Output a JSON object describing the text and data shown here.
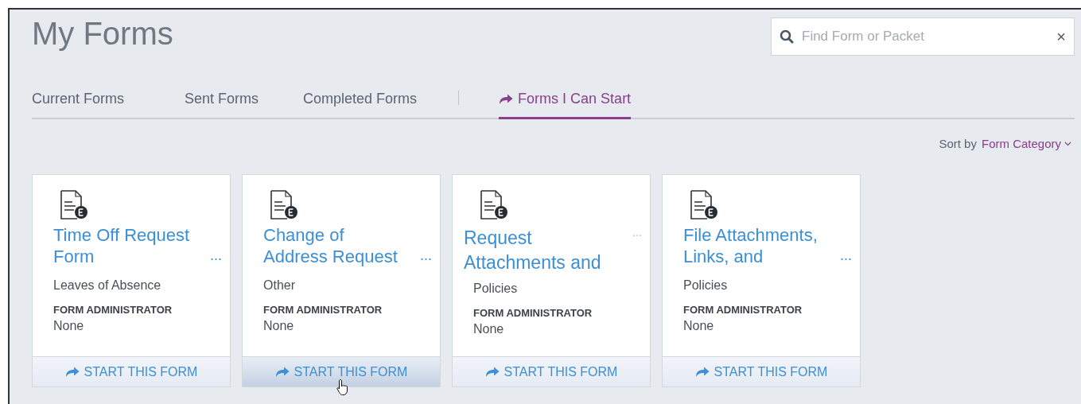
{
  "page": {
    "title": "My Forms"
  },
  "search": {
    "placeholder": "Find Form or Packet",
    "clear": "×"
  },
  "tabs": [
    {
      "label": "Current Forms",
      "selected": false
    },
    {
      "label": "Sent Forms",
      "selected": false
    },
    {
      "label": "Completed Forms",
      "selected": false
    },
    {
      "label": "Forms I Can Start",
      "selected": true
    }
  ],
  "sort": {
    "label": "Sort by",
    "value": "Form Category"
  },
  "cards": [
    {
      "title_lines": [
        "Time Off Request",
        "Form"
      ],
      "more": "...",
      "more_faded": false,
      "category": "Leaves of Absence",
      "admin_label": "FORM ADMINISTRATOR",
      "admin": "None",
      "button": "START THIS FORM",
      "hovered": false
    },
    {
      "title_lines": [
        "Change of",
        "Address Request"
      ],
      "more": "...",
      "more_faded": false,
      "category": "Other",
      "admin_label": "FORM ADMINISTRATOR",
      "admin": "None",
      "button": "START THIS FORM",
      "hovered": true
    },
    {
      "title_lines": [
        "Request",
        "Attachments and"
      ],
      "more": "...",
      "more_faded": true,
      "category": "Policies",
      "admin_label": "FORM ADMINISTRATOR",
      "admin": "None",
      "button": "START THIS FORM",
      "hovered": false
    },
    {
      "title_lines": [
        "File Attachments,",
        "Links, and"
      ],
      "more": "...",
      "more_faded": false,
      "category": "Policies",
      "admin_label": "FORM ADMINISTRATOR",
      "admin": "None",
      "button": "START THIS FORM",
      "hovered": false
    }
  ]
}
